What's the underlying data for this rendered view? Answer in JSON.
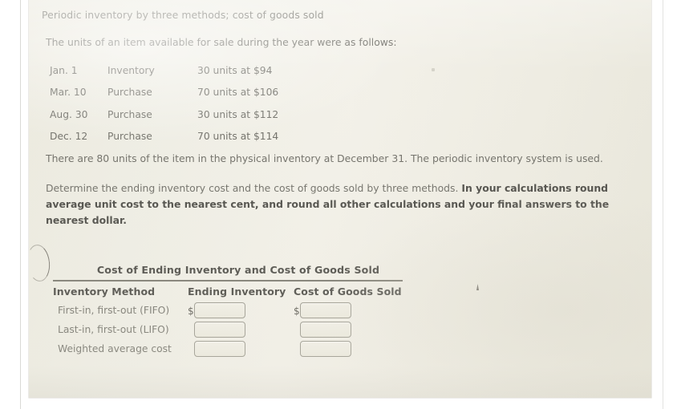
{
  "document": {
    "heading": "Periodic inventory by three methods; cost of goods sold",
    "intro": "The units of an item available for sale during the year were as follows:",
    "inventory_rows": [
      {
        "date": "Jan. 1",
        "type": "Inventory",
        "detail": "30 units at $94"
      },
      {
        "date": "Mar. 10",
        "type": "Purchase",
        "detail": "70 units at $106"
      },
      {
        "date": "Aug. 30",
        "type": "Purchase",
        "detail": "30 units at $112"
      },
      {
        "date": "Dec. 12",
        "type": "Purchase",
        "detail": "70 units at $114"
      }
    ],
    "physical_note": "There are 80 units of the item in the physical inventory at December 31. The periodic inventory system is used.",
    "instruction_plain_1": "Determine the ending inventory cost and the cost of goods sold by three methods. ",
    "instruction_bold": "In your calculations round average unit cost to the nearest cent, and round all other calculations and your final answers to the nearest dollar."
  },
  "answer_table": {
    "title": "Cost of Ending Inventory and Cost of Goods Sold",
    "columns": {
      "method": "Inventory Method",
      "ending_inventory": "Ending Inventory",
      "cost_of_goods_sold": "Cost of Goods Sold"
    },
    "currency_symbol": "$",
    "rows": [
      {
        "method": "First-in, first-out (FIFO)",
        "ending_inventory": "",
        "cost_of_goods_sold": "",
        "ei_placeholder": "",
        "cogs_placeholder": "",
        "show_dollar": true
      },
      {
        "method": "Last-in, first-out (LIFO)",
        "ending_inventory": "",
        "cost_of_goods_sold": "",
        "ei_placeholder": "",
        "cogs_placeholder": "",
        "show_dollar": false
      },
      {
        "method": "Weighted average cost",
        "ending_inventory": "",
        "cost_of_goods_sold": "",
        "ei_placeholder": "",
        "cogs_placeholder": "",
        "show_dollar": false
      }
    ]
  },
  "colors": {
    "paper": "#efeee5",
    "body_text": "#6f6e67",
    "bold_text": "#4b4a45",
    "rule": "#7c7a70",
    "input_border": "#9b998e"
  }
}
